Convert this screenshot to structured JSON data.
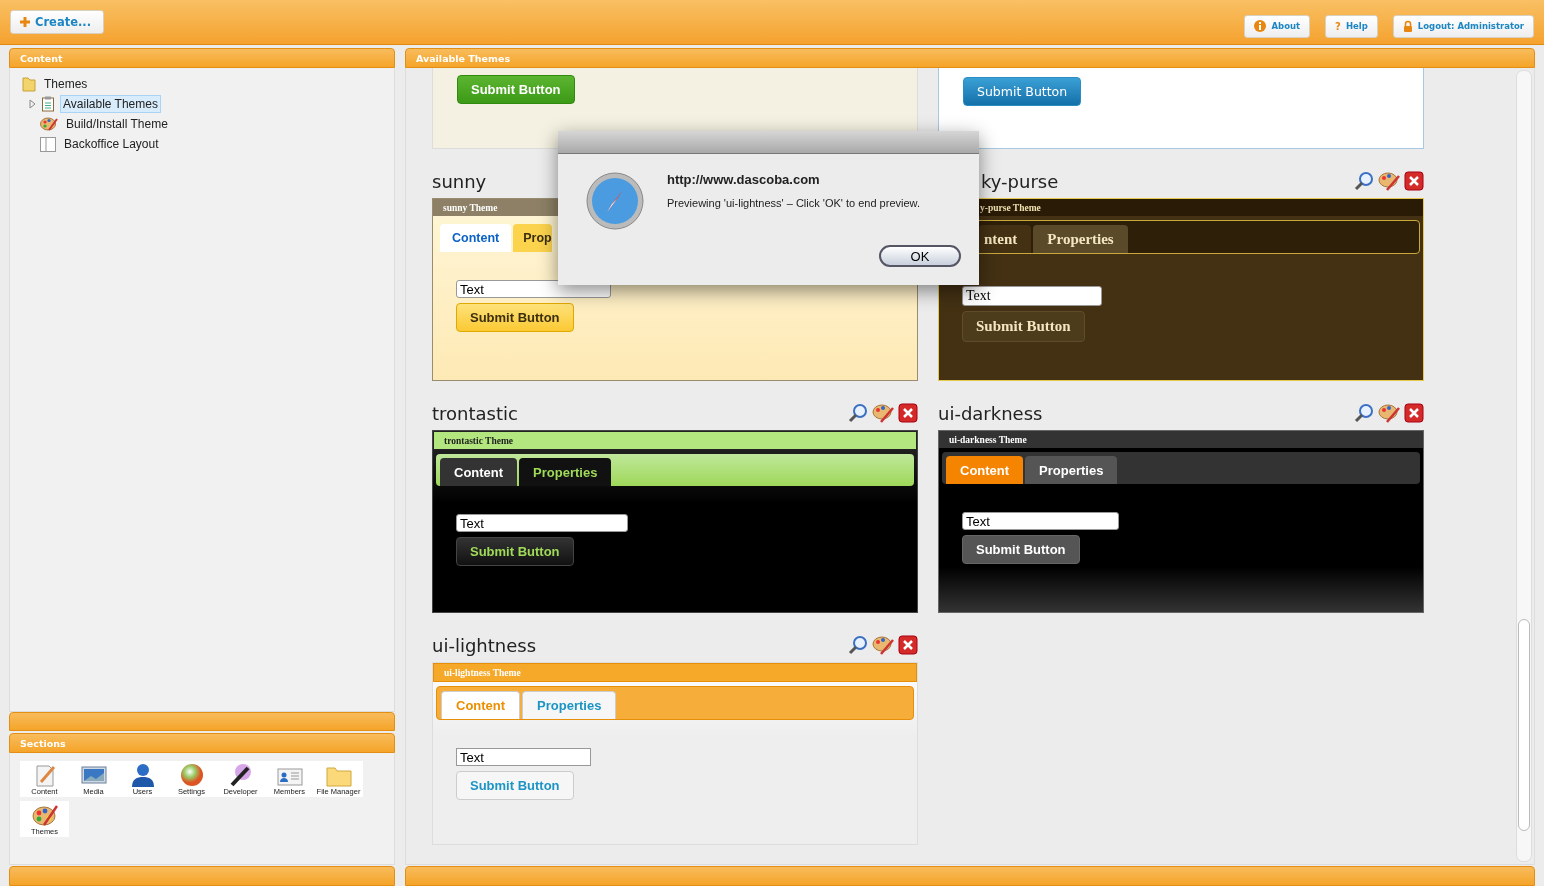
{
  "top_bar": {
    "create_button": "Create...",
    "buttons": [
      {
        "kind": "info",
        "label": "About"
      },
      {
        "kind": "help",
        "glyph": "?",
        "label": "Help"
      },
      {
        "kind": "lock",
        "label": "Logout: Administrator"
      }
    ]
  },
  "content_panel": {
    "title": "Content",
    "tree": [
      {
        "label": "Themes",
        "kind": "folder",
        "selected": false,
        "children": [
          {
            "label": "Available Themes",
            "kind": "document",
            "selected": true,
            "expanded": false
          },
          {
            "label": "Build/Install Theme",
            "kind": "palette",
            "selected": false
          },
          {
            "label": "Backoffice Layout",
            "kind": "layout",
            "selected": false
          }
        ]
      }
    ]
  },
  "sections_panel": {
    "title": "Sections",
    "items": [
      {
        "label": "Content",
        "kind": "content"
      },
      {
        "label": "Media",
        "kind": "media"
      },
      {
        "label": "Users",
        "kind": "users"
      },
      {
        "label": "Settings",
        "kind": "settings"
      },
      {
        "label": "Developer",
        "kind": "developer"
      },
      {
        "label": "Members",
        "kind": "members"
      },
      {
        "label": "File Manager",
        "kind": "files"
      },
      {
        "label": "Themes",
        "kind": "themes"
      }
    ]
  },
  "themes_panel": {
    "title": "Available Themes",
    "partial_cards": [
      {
        "kind": "green",
        "button": "Submit Button"
      },
      {
        "kind": "blue",
        "button": "Submit Button"
      }
    ],
    "themes": [
      {
        "kind": "sunny",
        "name": "sunny",
        "tools": false,
        "header": "sunny Theme",
        "tabs": [
          {
            "label": "Content",
            "selected": true
          },
          {
            "label": "Prop",
            "selected": false
          }
        ],
        "field": "Text",
        "button": "Submit Button"
      },
      {
        "kind": "sky-purse",
        "name": "ky-purse",
        "tools": true,
        "header": "y-purse Theme",
        "tabs": [
          {
            "label": "ntent",
            "selected": true
          },
          {
            "label": "Properties",
            "selected": false
          }
        ],
        "field": "Text",
        "button": "Submit Button"
      },
      {
        "kind": "trontastic",
        "name": "trontastic",
        "tools": true,
        "header": "trontastic Theme",
        "tabs": [
          {
            "label": "Content",
            "selected": true
          },
          {
            "label": "Properties",
            "selected": false
          }
        ],
        "field": "Text",
        "button": "Submit Button"
      },
      {
        "kind": "ui-darkness",
        "name": "ui-darkness",
        "tools": true,
        "header": "ui-darkness Theme",
        "tabs": [
          {
            "label": "Content",
            "selected": true
          },
          {
            "label": "Properties",
            "selected": false
          }
        ],
        "field": "Text",
        "button": "Submit Button"
      },
      {
        "kind": "ui-lightness",
        "name": "ui-lightness",
        "tools": true,
        "header": "ui-lightness Theme",
        "tabs": [
          {
            "label": "Content",
            "selected": true
          },
          {
            "label": "Properties",
            "selected": false
          }
        ],
        "field": "Text",
        "button": "Submit Button"
      }
    ]
  },
  "dialog": {
    "title": "http://www.dascoba.com",
    "message": "Previewing 'ui-lightness' – Click 'OK' to end preview.",
    "button": "OK"
  }
}
